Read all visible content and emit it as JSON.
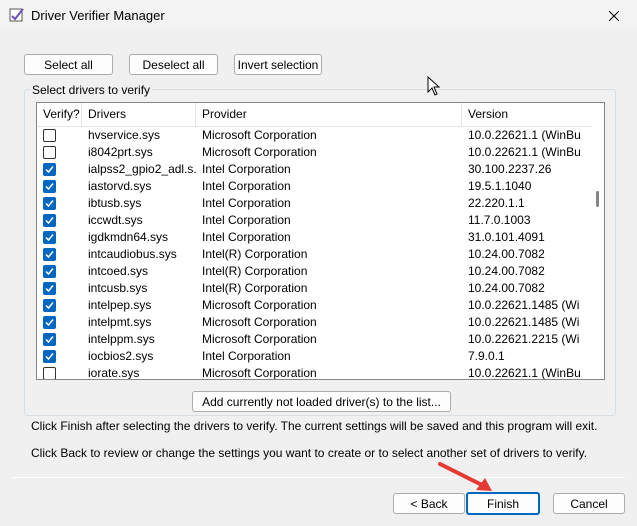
{
  "window": {
    "title": "Driver Verifier Manager",
    "icon": "verifier-app-icon"
  },
  "toolbar": {
    "select_all": "Select all",
    "deselect_all": "Deselect all",
    "invert_selection": "Invert selection"
  },
  "group": {
    "label": "Select drivers to verify"
  },
  "table": {
    "columns": [
      "Verify?",
      "Drivers",
      "Provider",
      "Version"
    ],
    "rows": [
      {
        "checked": false,
        "driver": "hvservice.sys",
        "provider": "Microsoft Corporation",
        "version": "10.0.22621.1 (WinBui..."
      },
      {
        "checked": false,
        "driver": "i8042prt.sys",
        "provider": "Microsoft Corporation",
        "version": "10.0.22621.1 (WinBui..."
      },
      {
        "checked": true,
        "driver": "ialpss2_gpio2_adl.s...",
        "provider": "Intel Corporation",
        "version": "30.100.2237.26"
      },
      {
        "checked": true,
        "driver": "iastorvd.sys",
        "provider": "Intel Corporation",
        "version": "19.5.1.1040"
      },
      {
        "checked": true,
        "driver": "ibtusb.sys",
        "provider": "Intel Corporation",
        "version": "22.220.1.1"
      },
      {
        "checked": true,
        "driver": "iccwdt.sys",
        "provider": "Intel Corporation",
        "version": "11.7.0.1003"
      },
      {
        "checked": true,
        "driver": "igdkmdn64.sys",
        "provider": "Intel Corporation",
        "version": "31.0.101.4091"
      },
      {
        "checked": true,
        "driver": "intcaudiobus.sys",
        "provider": "Intel(R) Corporation",
        "version": "10.24.00.7082"
      },
      {
        "checked": true,
        "driver": "intcoed.sys",
        "provider": "Intel(R) Corporation",
        "version": "10.24.00.7082"
      },
      {
        "checked": true,
        "driver": "intcusb.sys",
        "provider": "Intel(R) Corporation",
        "version": "10.24.00.7082"
      },
      {
        "checked": true,
        "driver": "intelpep.sys",
        "provider": "Microsoft Corporation",
        "version": "10.0.22621.1485 (Wi..."
      },
      {
        "checked": true,
        "driver": "intelpmt.sys",
        "provider": "Microsoft Corporation",
        "version": "10.0.22621.1485 (Wi..."
      },
      {
        "checked": true,
        "driver": "intelppm.sys",
        "provider": "Microsoft Corporation",
        "version": "10.0.22621.2215 (Wi..."
      },
      {
        "checked": true,
        "driver": "iocbios2.sys",
        "provider": "Intel Corporation",
        "version": "7.9.0.1"
      },
      {
        "checked": false,
        "driver": "iorate.sys",
        "provider": "Microsoft Corporation",
        "version": "10.0.22621.1 (WinBui..."
      }
    ]
  },
  "add_button": "Add currently not loaded driver(s) to the list...",
  "info": {
    "line1": "Click Finish after selecting the drivers to verify. The current settings will be saved and this program will exit.",
    "line2": "Click Back to review or change the settings you want to create or to select another set of drivers to verify."
  },
  "footer": {
    "back": "< Back",
    "finish": "Finish",
    "cancel": "Cancel"
  },
  "colors": {
    "accent": "#0067c0",
    "annotation_arrow": "#e53935"
  }
}
